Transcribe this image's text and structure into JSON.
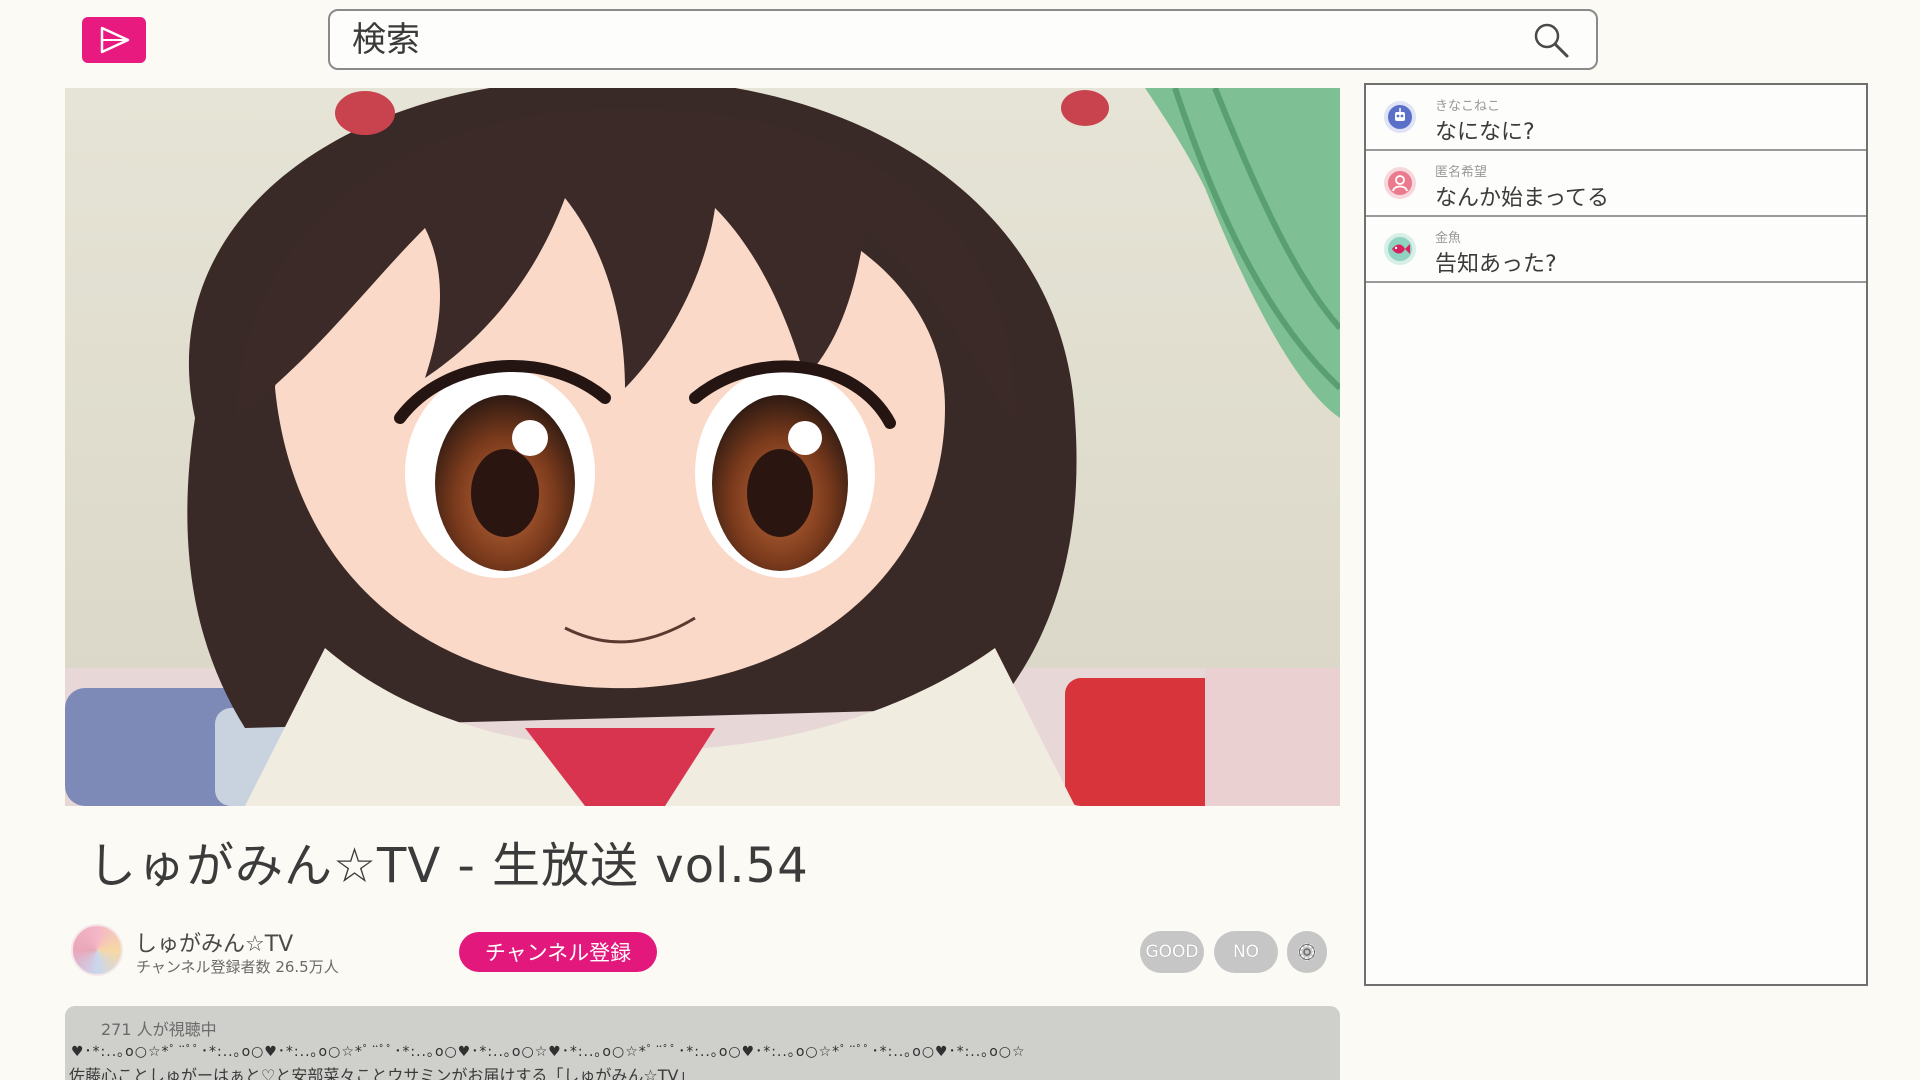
{
  "header": {
    "search_placeholder": "検索"
  },
  "video": {
    "title": "しゅがみん☆TV - 生放送 vol.54"
  },
  "channel": {
    "name": "しゅがみん☆TV",
    "subscribers": "チャンネル登録者数 26.5万人",
    "subscribe_label": "チャンネル登録"
  },
  "actions": {
    "good_label": "GOOD",
    "no_label": "NO",
    "settings_icon": "gear-icon"
  },
  "description": {
    "viewers": "271 人が視聴中",
    "decoration": "♥･*:..｡o○☆*ﾟ¨ﾟﾟ･*:..｡o○♥･*:..｡o○☆*ﾟ¨ﾟﾟ･*:..｡o○♥･*:..｡o○☆♥･*:..｡o○☆*ﾟ¨ﾟﾟ･*:..｡o○♥･*:..｡o○☆*ﾟ¨ﾟﾟ･*:..｡o○♥･*:..｡o○☆",
    "text": "佐藤心ことしゅがーはぁと♡と安部菜々ことウサミンがお届けする「しゅがみん☆TV」"
  },
  "chat": {
    "messages": [
      {
        "user": "きなこねこ",
        "text": "なになに?",
        "icon": "robot-avatar-icon",
        "color": "#5a6fc8"
      },
      {
        "user": "匿名希望",
        "text": "なんか始まってる",
        "icon": "person-avatar-icon",
        "color": "#ea7a8c"
      },
      {
        "user": "金魚",
        "text": "告知あった?",
        "icon": "goldfish-avatar-icon",
        "color": "#d8245e"
      }
    ]
  },
  "colors": {
    "accent": "#e2187d",
    "background": "#fbfaf4"
  }
}
